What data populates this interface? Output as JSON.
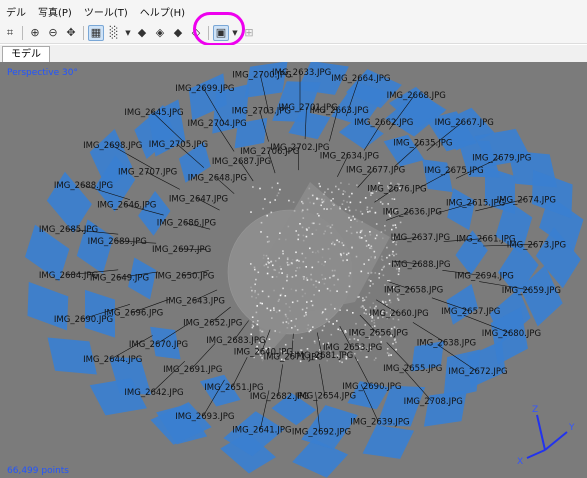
{
  "menu": {
    "items": [
      "デル",
      "写真(P)",
      "ツール(T)",
      "ヘルプ(H)"
    ]
  },
  "toolbar": {
    "icons": [
      "grid-icon",
      "zoom-in-icon",
      "zoom-out-icon",
      "move-icon",
      "view-mode-icon",
      "dots-icon",
      "dropdown-arrow-icon",
      "cube-left-icon",
      "cube-front-icon",
      "cube-right-icon",
      "cube-top-icon",
      "camera-display-icon",
      "dropdown-arrow-icon",
      "reset-icon"
    ],
    "highlight_color": "#ee00ee"
  },
  "tabs": [
    "モデル"
  ],
  "viewport": {
    "projection": "Perspective 30°",
    "point_count": "66,499 points",
    "background": "#7b7b7b",
    "camera_color": "#3a7fd0",
    "axis_labels": [
      "Z",
      "Y",
      "X"
    ],
    "cameras": [
      "IMG_2633.JPG",
      "IMG_2663.JPG",
      "IMG_2634.JPG",
      "IMG_2664.JPG",
      "IMG_2662.JPG",
      "IMG_2677.JPG",
      "IMG_2668.JPG",
      "IMG_2635.JPG",
      "IMG_2676.JPG",
      "IMG_2667.JPG",
      "IMG_2675.JPG",
      "IMG_2636.JPG",
      "IMG_2679.JPG",
      "IMG_2615.JPG",
      "IMG_2637.JPG",
      "IMG_2674.JPG",
      "IMG_2661.JPG",
      "IMG_2688.JPG",
      "IMG_2673.JPG",
      "IMG_2694.JPG",
      "IMG_2658.JPG",
      "IMG_2659.JPG",
      "IMG_2657.JPG",
      "IMG_2660.JPG",
      "IMG_2680.JPG",
      "IMG_2638.JPG",
      "IMG_2656.JPG",
      "IMG_2672.JPG",
      "IMG_2655.JPG",
      "IMG_2653.JPG",
      "IMG_2708.JPG",
      "IMG_2690.JPG",
      "IMG_2681.JPG",
      "IMG_2639.JPG",
      "IMG_2654.JPG",
      "IMG_2671.JPG",
      "IMG_2692.JPG",
      "IMG_2682.JPG",
      "IMG_2640.JPG",
      "IMG_2641.JPG",
      "IMG_2651.JPG",
      "IMG_2683.JPG",
      "IMG_2693.JPG",
      "IMG_2691.JPG",
      "IMG_2652.JPG",
      "IMG_2642.JPG",
      "IMG_2670.JPG",
      "IMG_2643.JPG",
      "IMG_2644.JPG",
      "IMG_2696.JPG",
      "IMG_2650.JPG",
      "IMG_2690.JPG",
      "IMG_2649.JPG",
      "IMG_2697.JPG",
      "IMG_2684.JPG",
      "IMG_2689.JPG",
      "IMG_2686.JPG",
      "IMG_2685.JPG",
      "IMG_2646.JPG",
      "IMG_2647.JPG",
      "IMG_2688.JPG",
      "IMG_2707.JPG",
      "IMG_2648.JPG",
      "IMG_2698.JPG",
      "IMG_2705.JPG",
      "IMG_2687.JPG",
      "IMG_2645.JPG",
      "IMG_2704.JPG",
      "IMG_2706.JPG",
      "IMG_2699.JPG",
      "IMG_2703.JPG",
      "IMG_2702.JPG",
      "IMG_2700.JPG",
      "IMG_2701.JPG"
    ]
  }
}
